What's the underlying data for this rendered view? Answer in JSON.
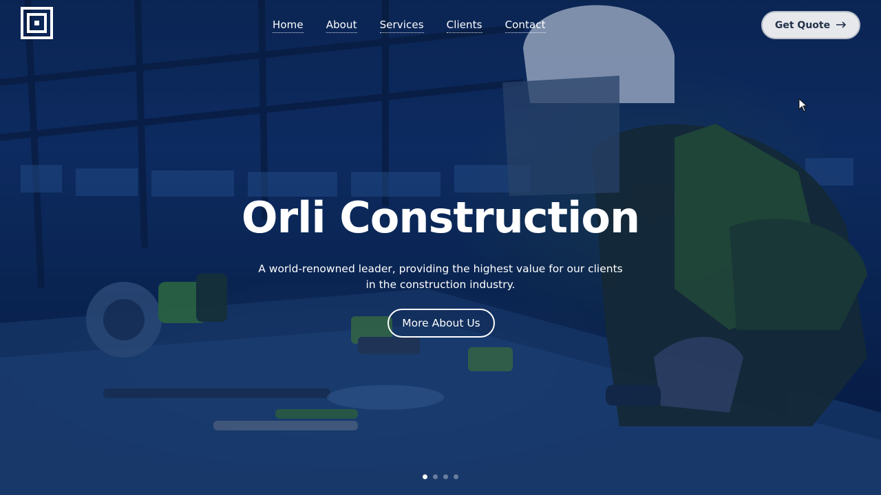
{
  "brand": {
    "logo": "square-logo-icon"
  },
  "nav": {
    "items": [
      {
        "label": "Home"
      },
      {
        "label": "About"
      },
      {
        "label": "Services"
      },
      {
        "label": "Clients"
      },
      {
        "label": "Contact"
      }
    ]
  },
  "header": {
    "cta_label": "Get Quote",
    "cta_icon": "arrow-right-icon"
  },
  "hero": {
    "title": "Orli Construction",
    "subtitle_line1": "A world-renowned leader, providing the highest value for our clients",
    "subtitle_line2": "in the construction industry.",
    "button_label": "More About Us",
    "slides_total": 4,
    "active_slide": 1
  },
  "colors": {
    "overlay": "#0b2a5c",
    "cta_bg": "#e6e8ec",
    "cta_text": "#24324a",
    "text": "#ffffff"
  }
}
